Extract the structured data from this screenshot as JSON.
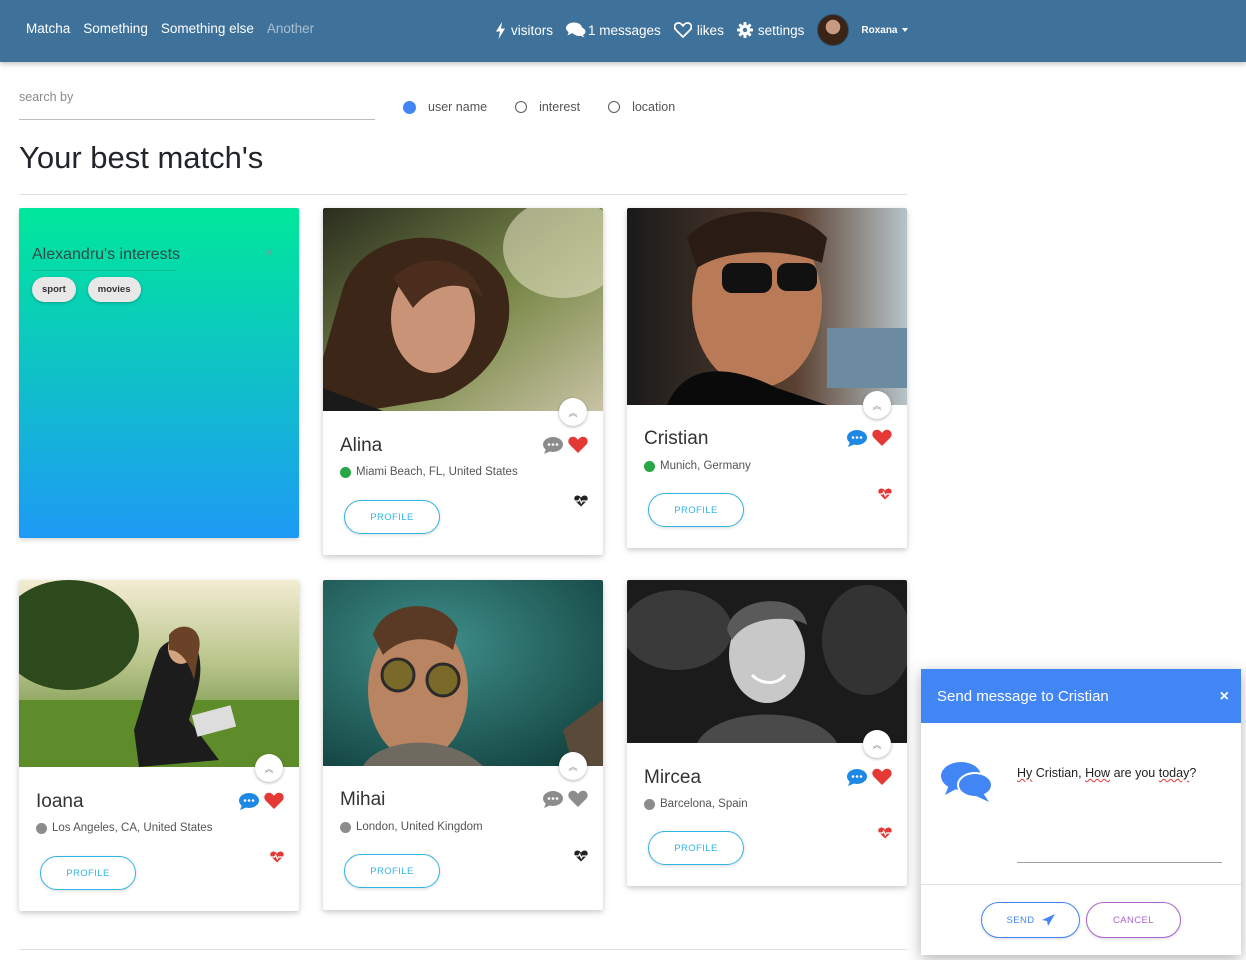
{
  "navbar": {
    "brand": "Matcha",
    "links": [
      "Something",
      "Something else",
      "Another"
    ],
    "visitors_label": "visitors",
    "messages_label": "1 messages",
    "likes_label": "likes",
    "settings_label": "settings",
    "user_name": "Roxana"
  },
  "search": {
    "placeholder": "search by",
    "options": [
      {
        "label": "user name",
        "selected": true
      },
      {
        "label": "interest",
        "selected": false
      },
      {
        "label": "location",
        "selected": false
      }
    ]
  },
  "page_title": "Your best match's",
  "interests_card": {
    "title": "Alexandru's interests",
    "close_icon": "×",
    "tags": [
      "sport",
      "movies"
    ]
  },
  "profiles": [
    {
      "name": "Alina",
      "location": "Miami Beach, FL, United States",
      "online": true,
      "liked": true,
      "messaged": false,
      "button": "PROFILE"
    },
    {
      "name": "Cristian",
      "location": "Munich, Germany",
      "online": true,
      "liked": true,
      "messaged": true,
      "button": "PROFILE"
    },
    {
      "name": "Ioana",
      "location": "Los Angeles, CA, United States",
      "online": false,
      "liked": true,
      "messaged": true,
      "button": "PROFILE"
    },
    {
      "name": "Mihai",
      "location": "London, United Kingdom",
      "online": false,
      "liked": false,
      "messaged": false,
      "button": "PROFILE"
    },
    {
      "name": "Mircea",
      "location": "Barcelona, Spain",
      "online": false,
      "liked": true,
      "messaged": true,
      "button": "PROFILE"
    }
  ],
  "colors": {
    "navbar": "#3f729b",
    "like": "#e53935",
    "message_active": "#1e88e5",
    "inactive": "#8c8c8c",
    "online": "#28a745",
    "accent_blue": "#4285f4"
  },
  "modal": {
    "title": "Send message to Cristian",
    "close_icon": "×",
    "message": "Hy Cristian, How are you today?",
    "message_parts": [
      "Hy",
      " Cristian, ",
      "How",
      " are you ",
      "today",
      "?"
    ],
    "send_label": "SEND",
    "cancel_label": "CANCEL"
  }
}
